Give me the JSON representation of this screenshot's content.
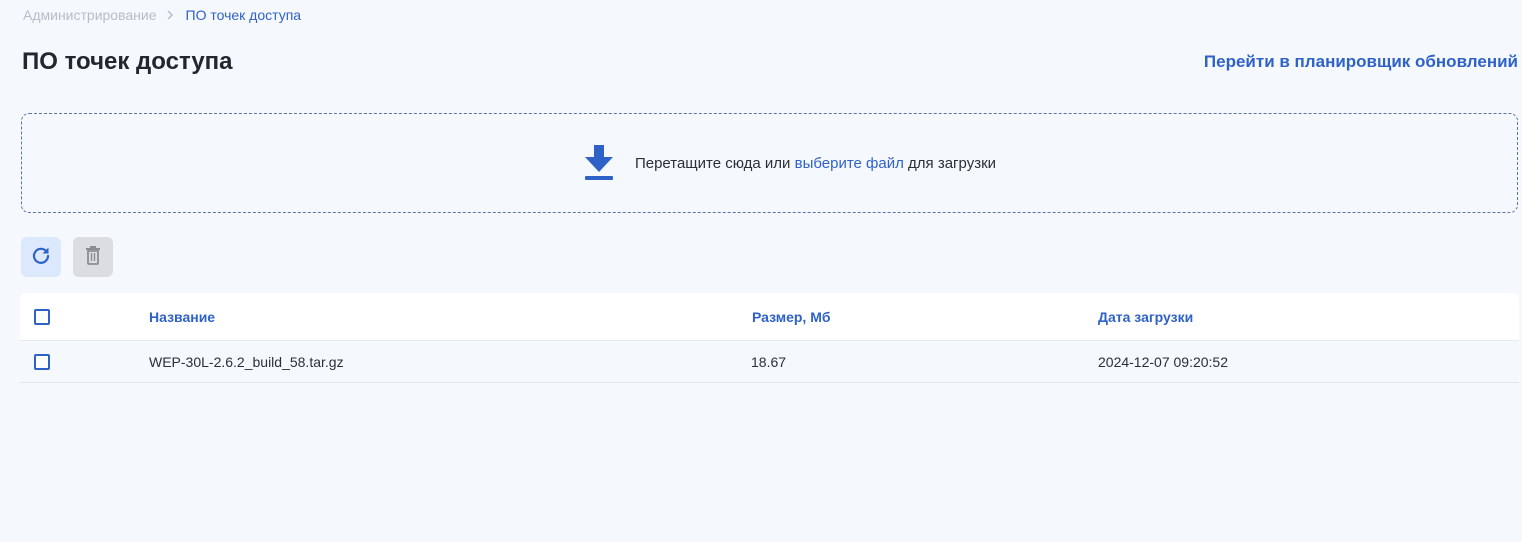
{
  "breadcrumb": {
    "root": "Администрирование",
    "current": "ПО точек доступа"
  },
  "page": {
    "title": "ПО точек доступа",
    "scheduler_link": "Перейти в планировщик обновлений"
  },
  "dropzone": {
    "text_before": "Перетащите сюда или ",
    "link": "выберите файл",
    "text_after": " для загрузки",
    "icon": "download-icon"
  },
  "toolbar": {
    "refresh_icon": "refresh-icon",
    "delete_icon": "trash-icon"
  },
  "table": {
    "columns": [
      "Название",
      "Размер, Мб",
      "Дата загрузки"
    ],
    "rows": [
      {
        "name": "WEP-30L-2.6.2_build_58.tar.gz",
        "size": "18.67",
        "date": "2024-12-07 09:20:52"
      }
    ]
  },
  "colors": {
    "accent": "#2f62c8",
    "background": "#f5f8fd"
  }
}
